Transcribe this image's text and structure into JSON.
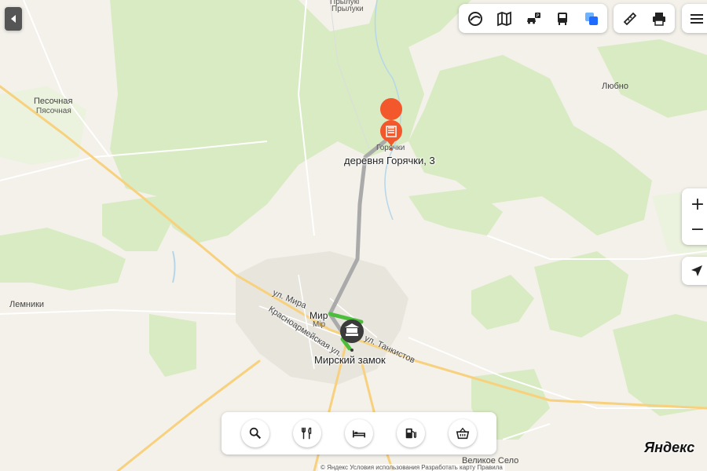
{
  "places": {
    "pryluki": "Прылукі",
    "pryluki_ru": "Прылуки",
    "lyubno": "Любно",
    "pesochnaya_by": "Песочная",
    "pesochnaya_ru": "Пясочная",
    "goryachki_small": "Горячки",
    "goryachki_big": "деревня Горячки, 3",
    "lemniki": "Лемники",
    "mir": "Мир",
    "mir_small": "Мір",
    "mir_castle": "Мирский замок",
    "velikoe_selo": "Великое Село"
  },
  "streets": {
    "mira": "ул. Мира",
    "krasnoarmeyskaya": "Красноармейская ул.",
    "tankistov": "ул. Танкистов"
  },
  "toolbar": {
    "icons": [
      "layers-icon",
      "traffic-map-icon",
      "parking-icon",
      "transit-icon",
      "panorama-icon"
    ],
    "tools": [
      "ruler-icon",
      "print-icon"
    ]
  },
  "bottom_bar": {
    "icons": [
      "search-icon",
      "food-icon",
      "hotel-icon",
      "fuel-icon",
      "shopping-icon"
    ]
  },
  "zoom": {
    "plus": "+",
    "minus": "−"
  },
  "logo": "Яндекс",
  "attribution": "© Яндекс  Условия использования  Разработать карту  Правила",
  "colors": {
    "route": "#aaaaaa",
    "route_active": "#4cbe3b",
    "pin": "#f2582c",
    "forest": "#d8ebc2",
    "road_main": "#f7d17e"
  }
}
